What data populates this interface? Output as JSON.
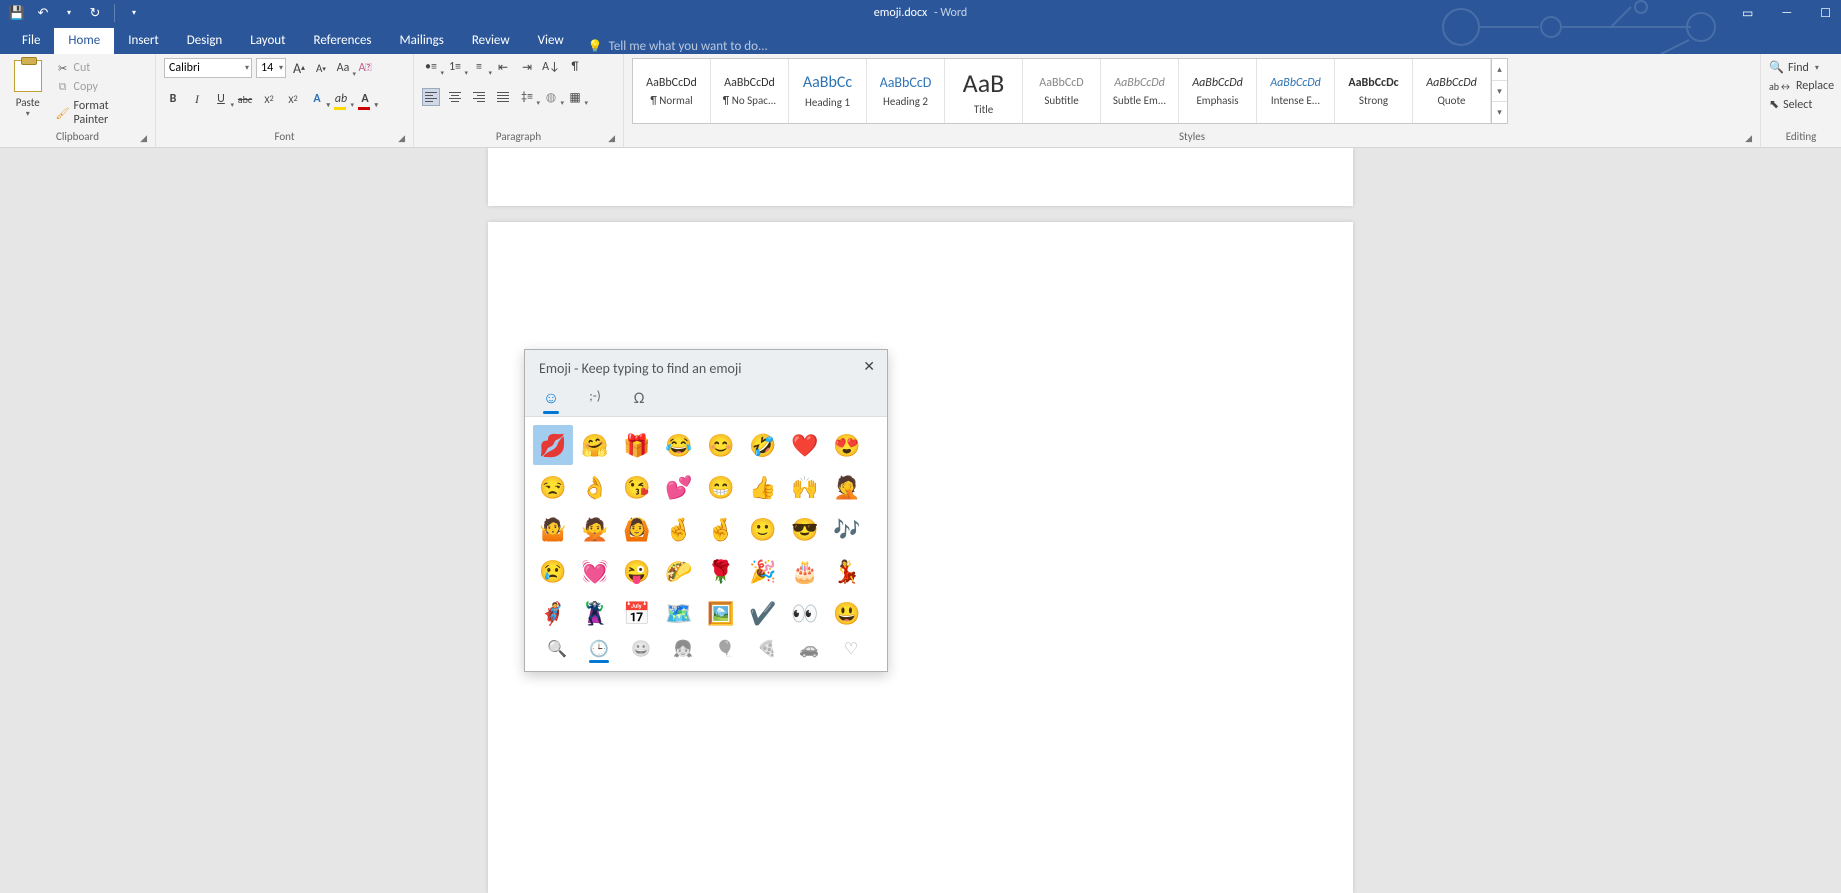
{
  "title": {
    "filename": "emoji.docx",
    "app": "- Word"
  },
  "tabs": {
    "file": "File",
    "home": "Home",
    "insert": "Insert",
    "design": "Design",
    "layout": "Layout",
    "references": "References",
    "mailings": "Mailings",
    "review": "Review",
    "view": "View",
    "tellme_placeholder": "Tell me what you want to do..."
  },
  "clipboard": {
    "paste": "Paste",
    "cut": "Cut",
    "copy": "Copy",
    "format_painter": "Format Painter",
    "group": "Clipboard"
  },
  "font": {
    "name": "Calibri",
    "size": "14",
    "group": "Font"
  },
  "paragraph": {
    "group": "Paragraph"
  },
  "styles": {
    "group": "Styles",
    "items": [
      {
        "preview": "AaBbCcDd",
        "name": "¶ Normal",
        "color": "#333",
        "size": "12px",
        "weight": "normal",
        "style": "normal"
      },
      {
        "preview": "AaBbCcDd",
        "name": "¶ No Spac...",
        "color": "#333",
        "size": "12px",
        "weight": "normal",
        "style": "normal"
      },
      {
        "preview": "AaBbCc",
        "name": "Heading 1",
        "color": "#2e74b5",
        "size": "16px",
        "weight": "normal",
        "style": "normal"
      },
      {
        "preview": "AaBbCcD",
        "name": "Heading 2",
        "color": "#2e74b5",
        "size": "14px",
        "weight": "normal",
        "style": "normal"
      },
      {
        "preview": "AaB",
        "name": "Title",
        "color": "#333",
        "size": "26px",
        "weight": "normal",
        "style": "normal"
      },
      {
        "preview": "AaBbCcD",
        "name": "Subtitle",
        "color": "#888",
        "size": "12px",
        "weight": "normal",
        "style": "normal"
      },
      {
        "preview": "AaBbCcDd",
        "name": "Subtle Em...",
        "color": "#888",
        "size": "12px",
        "weight": "normal",
        "style": "italic"
      },
      {
        "preview": "AaBbCcDd",
        "name": "Emphasis",
        "color": "#333",
        "size": "12px",
        "weight": "normal",
        "style": "italic"
      },
      {
        "preview": "AaBbCcDd",
        "name": "Intense E...",
        "color": "#2e74b5",
        "size": "12px",
        "weight": "normal",
        "style": "italic"
      },
      {
        "preview": "AaBbCcDc",
        "name": "Strong",
        "color": "#333",
        "size": "12px",
        "weight": "bold",
        "style": "normal"
      },
      {
        "preview": "AaBbCcDd",
        "name": "Quote",
        "color": "#333",
        "size": "12px",
        "weight": "normal",
        "style": "italic"
      }
    ]
  },
  "editing": {
    "find": "Find",
    "replace": "Replace",
    "select": "Select",
    "group": "Editing"
  },
  "emoji_panel": {
    "title": "Emoji - Keep typing to find an emoji",
    "tabs": [
      {
        "name": "emoji",
        "glyph": "☺"
      },
      {
        "name": "kaomoji",
        "glyph": ";-)"
      },
      {
        "name": "symbols",
        "glyph": "Ω"
      }
    ],
    "grid": [
      [
        "💋",
        "🤗",
        "🎁",
        "😂",
        "😊",
        "🤣",
        "❤️",
        "😍"
      ],
      [
        "😒",
        "👌",
        "😘",
        "💕",
        "😁",
        "👍",
        "🙌",
        "🤦"
      ],
      [
        "🤷",
        "🙅",
        "🙆",
        "🤞",
        "🤞",
        "🙂",
        "😎",
        "🎶"
      ],
      [
        "😢",
        "💓",
        "😜",
        "🌮",
        "🌹",
        "🎉",
        "🎂",
        "💃"
      ],
      [
        "🦸",
        "🦹",
        "📅",
        "🗺️",
        "🖼️",
        "✔️",
        "👀",
        "😃"
      ]
    ],
    "categories": [
      {
        "name": "search",
        "glyph": "🔍"
      },
      {
        "name": "recent",
        "glyph": "🕒"
      },
      {
        "name": "smileys",
        "glyph": "😀"
      },
      {
        "name": "people",
        "glyph": "👧"
      },
      {
        "name": "celebration",
        "glyph": "🎈"
      },
      {
        "name": "food",
        "glyph": "🍕"
      },
      {
        "name": "transport",
        "glyph": "🚗"
      },
      {
        "name": "heart",
        "glyph": "♡"
      }
    ]
  }
}
